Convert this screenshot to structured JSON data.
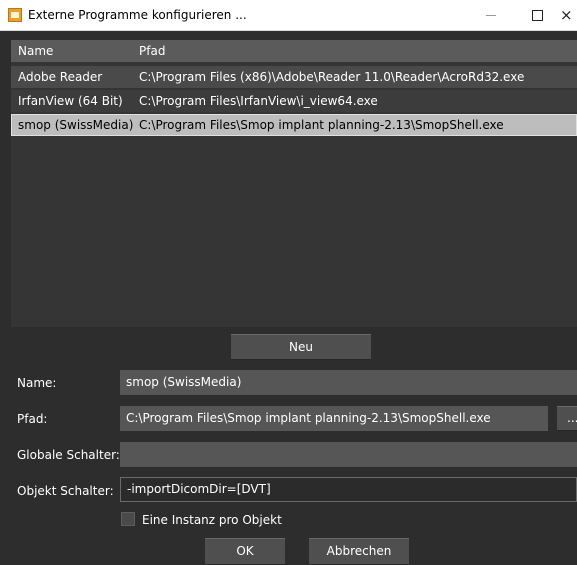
{
  "window": {
    "title": "Externe Programme konfigurieren ...",
    "icon": "app-icon",
    "minimize_icon": "minimize-icon",
    "maximize_icon": "maximize-icon",
    "close_glyph": "×"
  },
  "list": {
    "columns": [
      "Name",
      "Pfad"
    ],
    "rows": [
      {
        "name": "Adobe Reader",
        "path": "C:\\Program Files (x86)\\Adobe\\Reader 11.0\\Reader\\AcroRd32.exe",
        "selected": false
      },
      {
        "name": "IrfanView (64 Bit)",
        "path": "C:\\Program Files\\IrfanView\\i_view64.exe",
        "selected": false
      },
      {
        "name": "smop (SwissMedia)",
        "path": "C:\\Program Files\\Smop implant planning-2.13\\SmopShell.exe",
        "selected": true
      }
    ],
    "delete_icon": "delete-icon",
    "delete_glyph": "✕",
    "delete_color": "#d81818"
  },
  "buttons": {
    "new_label": "Neu",
    "ok_label": "OK",
    "cancel_label": "Abbrechen",
    "browse_label": "..."
  },
  "form": {
    "name_label": "Name:",
    "name_value": "smop (SwissMedia)",
    "path_label": "Pfad:",
    "path_value": "C:\\Program Files\\Smop implant planning-2.13\\SmopShell.exe",
    "global_switch_label": "Globale Schalter:",
    "global_switch_value": "",
    "object_switch_label": "Objekt Schalter:",
    "object_switch_value": "-importDicomDir=[DVT]",
    "instance_checkbox_label": "Eine Instanz pro Objekt",
    "instance_checkbox_checked": false
  }
}
